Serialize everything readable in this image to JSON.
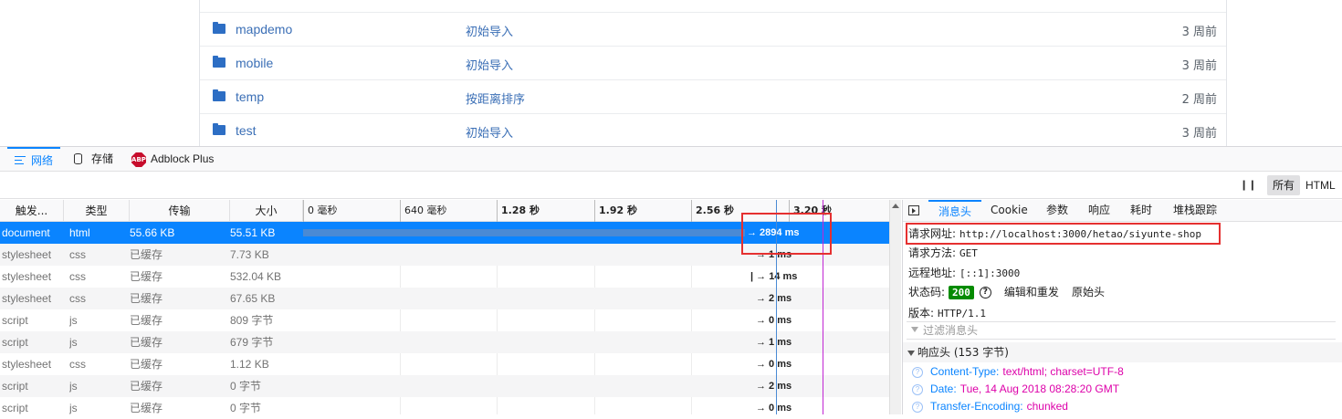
{
  "repo": {
    "rows": [
      {
        "name": "mapdemo",
        "message": "初始导入",
        "age": "3 周前"
      },
      {
        "name": "mobile",
        "message": "初始导入",
        "age": "3 周前"
      },
      {
        "name": "temp",
        "message": "按距离排序",
        "age": "2 周前"
      },
      {
        "name": "test",
        "message": "初始导入",
        "age": "3 周前"
      }
    ]
  },
  "devtools": {
    "tabs": {
      "network": "网络",
      "storage": "存储",
      "adblock": "Adblock Plus",
      "abp_badge": "ABP"
    },
    "filter": {
      "pause": "❙❙",
      "all": "所有",
      "html": "HTML"
    }
  },
  "table": {
    "headers": {
      "initiator": "触发...",
      "type": "类型",
      "transferred": "传输",
      "size": "大小"
    },
    "ticks": [
      "0 毫秒",
      "640 毫秒",
      "1.28 秒",
      "1.92 秒",
      "2.56 秒",
      "3.20 秒"
    ],
    "rows": [
      {
        "initiator": "document",
        "type": "html",
        "transferred": "55.66 KB",
        "size": "55.51 KB",
        "timing": "→ 2894 ms"
      },
      {
        "initiator": "stylesheet",
        "type": "css",
        "transferred": "已缓存",
        "size": "7.73 KB",
        "timing": "→ 1 ms"
      },
      {
        "initiator": "stylesheet",
        "type": "css",
        "transferred": "已缓存",
        "size": "532.04 KB",
        "timing": "| → 14 ms"
      },
      {
        "initiator": "stylesheet",
        "type": "css",
        "transferred": "已缓存",
        "size": "67.65 KB",
        "timing": "→ 2 ms"
      },
      {
        "initiator": "script",
        "type": "js",
        "transferred": "已缓存",
        "size": "809 字节",
        "timing": "→ 0 ms"
      },
      {
        "initiator": "script",
        "type": "js",
        "transferred": "已缓存",
        "size": "679 字节",
        "timing": "→ 1 ms"
      },
      {
        "initiator": "stylesheet",
        "type": "css",
        "transferred": "已缓存",
        "size": "1.12 KB",
        "timing": "→ 0 ms"
      },
      {
        "initiator": "script",
        "type": "js",
        "transferred": "已缓存",
        "size": "0 字节",
        "timing": "→ 2 ms"
      },
      {
        "initiator": "script",
        "type": "js",
        "transferred": "已缓存",
        "size": "0 字节",
        "timing": "→ 0 ms"
      }
    ]
  },
  "side": {
    "tabs": [
      "消息头",
      "Cookie",
      "参数",
      "响应",
      "耗时",
      "堆栈跟踪"
    ],
    "request_url_label": "请求网址:",
    "request_url": "http://localhost:3000/hetao/siyunte-shop",
    "method_label": "请求方法:",
    "method": "GET",
    "remote_label": "远程地址:",
    "remote": "[::1]:3000",
    "status_label": "状态码:",
    "status": "200",
    "help": "?",
    "edit_resend": "编辑和重发",
    "raw_headers": "原始头",
    "version_label": "版本:",
    "version": "HTTP/1.1",
    "filter_placeholder": "过滤消息头",
    "response_section": "响应头 (153 字节)",
    "response_headers": [
      {
        "name": "Content-Type:",
        "value": "text/html; charset=UTF-8"
      },
      {
        "name": "Date:",
        "value": "Tue, 14 Aug 2018 08:28:20 GMT"
      },
      {
        "name": "Transfer-Encoding:",
        "value": "chunked"
      }
    ]
  },
  "colors": {
    "accent": "#0a84ff",
    "annotation": "#e53030",
    "status_ok": "#058b00"
  }
}
